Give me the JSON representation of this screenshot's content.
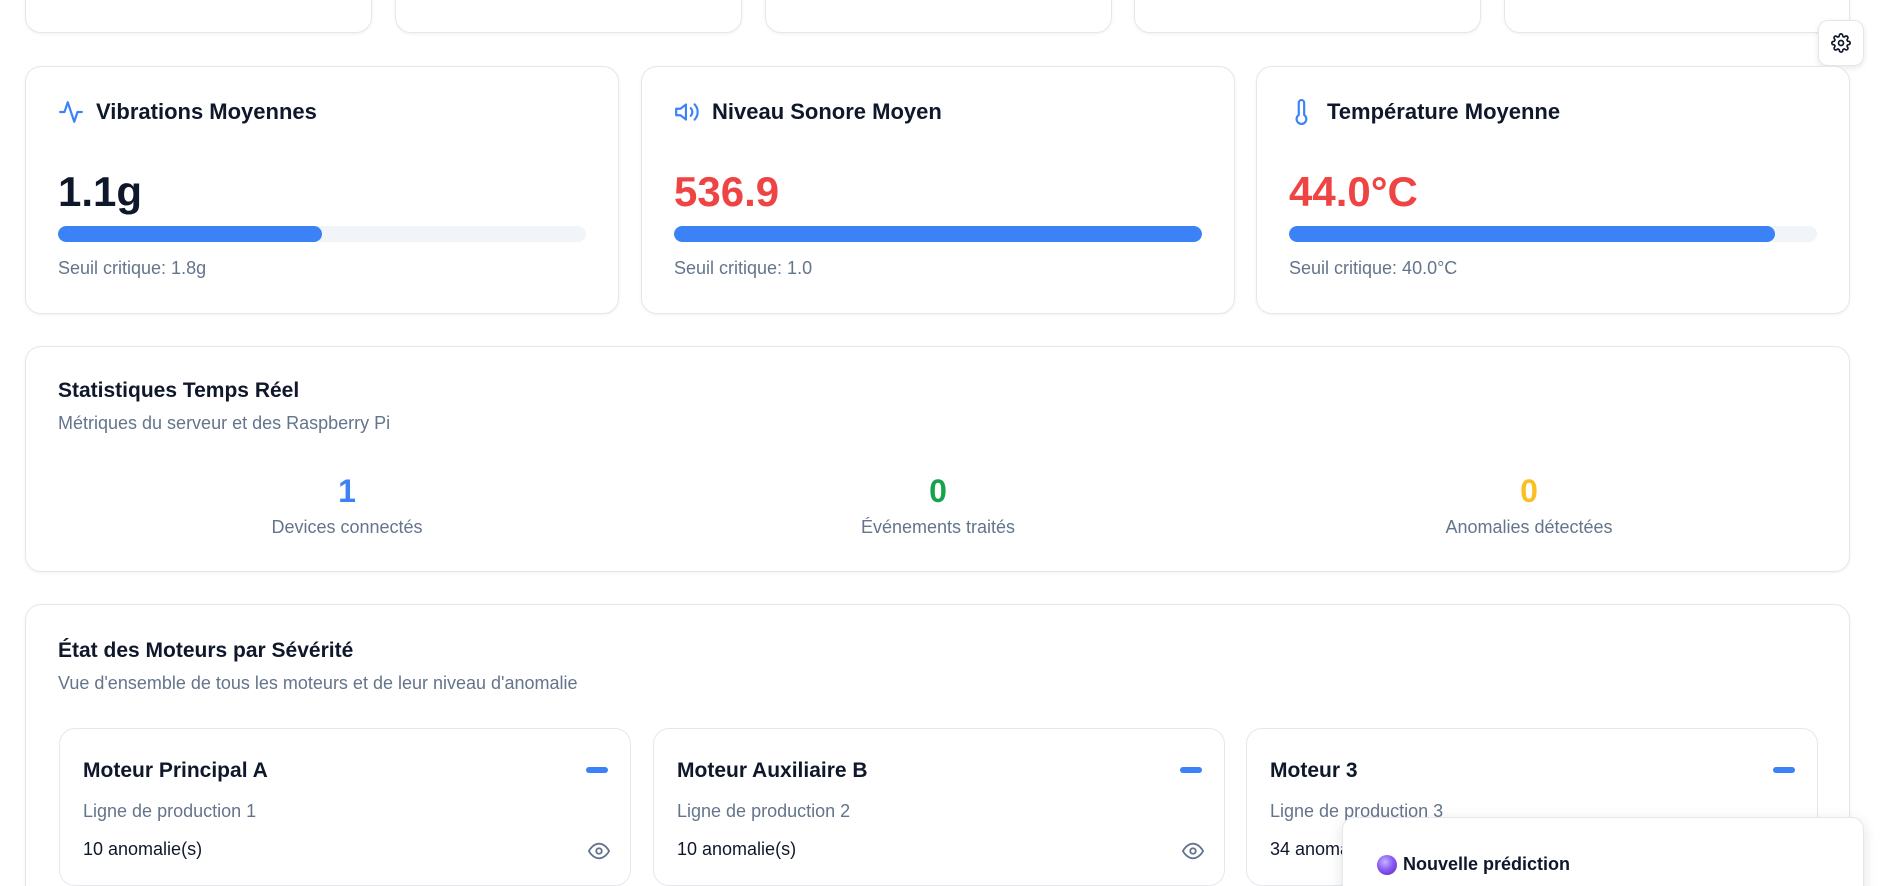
{
  "metrics": [
    {
      "title": "Vibrations Moyennes",
      "icon": "activity-icon",
      "value": "1.1g",
      "value_color": "#0f172a",
      "progress": 0.5,
      "threshold_label": "Seuil critique: 1.8g"
    },
    {
      "title": "Niveau Sonore Moyen",
      "icon": "speaker-icon",
      "value": "536.9",
      "value_color": "#ef4444",
      "progress": 1.0,
      "threshold_label": "Seuil critique: 1.0"
    },
    {
      "title": "Température Moyenne",
      "icon": "thermometer-icon",
      "value": "44.0°C",
      "value_color": "#ef4444",
      "progress": 0.92,
      "threshold_label": "Seuil critique: 40.0°C"
    }
  ],
  "stats": {
    "title": "Statistiques Temps Réel",
    "subtitle": "Métriques du serveur et des Raspberry Pi",
    "items": [
      {
        "value": "1",
        "label": "Devices connectés",
        "color": "#3b82f6"
      },
      {
        "value": "0",
        "label": "Événements traités",
        "color": "#16a34a"
      },
      {
        "value": "0",
        "label": "Anomalies détectées",
        "color": "#fbbf24"
      }
    ]
  },
  "motors": {
    "title": "État des Moteurs par Sévérité",
    "subtitle": "Vue d'ensemble de tous les moteurs et de leur niveau d'anomalie",
    "items": [
      {
        "name": "Moteur Principal A",
        "line": "Ligne de production 1",
        "count": "10 anomalie(s)"
      },
      {
        "name": "Moteur Auxiliaire B",
        "line": "Ligne de production 2",
        "count": "10 anomalie(s)"
      },
      {
        "name": "Moteur 3",
        "line": "Ligne de production 3",
        "count": "34 anomalie(s)"
      }
    ]
  },
  "toast": {
    "title": "Nouvelle prédiction"
  },
  "colors": {
    "accent": "#3b82f6",
    "danger": "#ef4444",
    "muted": "#64748b"
  }
}
